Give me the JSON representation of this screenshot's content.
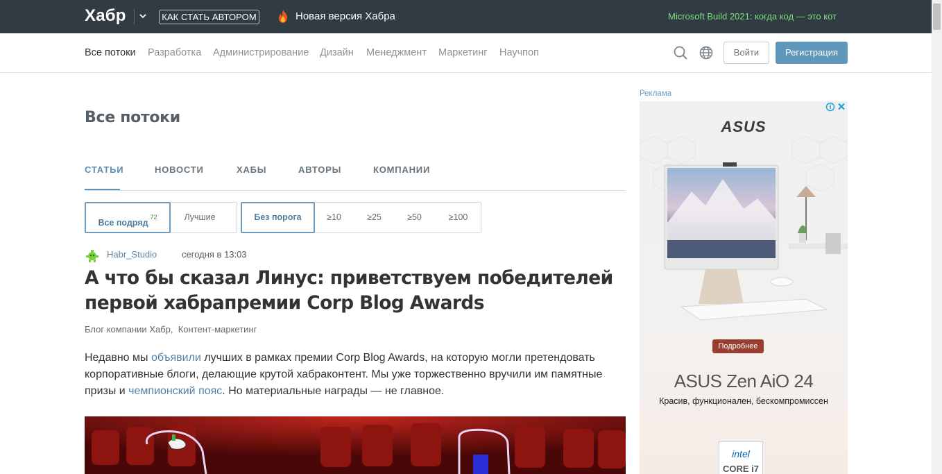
{
  "topbar": {
    "logo": "Хабр",
    "author_button": "КАК СТАТЬ АВТОРОМ",
    "new_version": "Новая версия Хабра",
    "promo_link": "Microsoft Build 2021: когда код — это кот",
    "colors": {
      "background": "#303b44",
      "promo": "#7ee07e"
    }
  },
  "nav": {
    "items": [
      {
        "label": "Все потоки",
        "active": true
      },
      {
        "label": "Разработка"
      },
      {
        "label": "Администрирование"
      },
      {
        "label": "Дизайн"
      },
      {
        "label": "Менеджмент"
      },
      {
        "label": "Маркетинг"
      },
      {
        "label": "Научпоп"
      }
    ],
    "search_icon": "search-icon",
    "language_icon": "globe-icon",
    "login": "Войти",
    "register": "Регистрация",
    "colors": {
      "register_button": "#5e96bc"
    }
  },
  "page": {
    "title": "Все потоки",
    "tabs": [
      {
        "label": "СТАТЬИ",
        "active": true
      },
      {
        "label": "НОВОСТИ"
      },
      {
        "label": "ХАБЫ"
      },
      {
        "label": "АВТОРЫ"
      },
      {
        "label": "КОМПАНИИ"
      }
    ],
    "sort_filters": {
      "all": "Все подряд",
      "all_count": "72",
      "best": "Лучшие"
    },
    "threshold_filters": [
      "Без порога",
      "≥10",
      "≥25",
      "≥50",
      "≥100"
    ]
  },
  "post": {
    "author": "Habr_Studio",
    "time": "сегодня в 13:03",
    "title": "А что бы сказал Линус: приветствуем победителей первой хабрапремии Corp Blog Awards",
    "hubs": [
      "Блог компании Хабр,",
      "Контент-маркетинг"
    ],
    "body": {
      "part1": "Недавно мы ",
      "link1": "объявили",
      "part2": " лучших в рамках премии Corp Blog Awards, на которую могли претендовать корпоративные блоги, делающие крутой хабраконтент. Мы уже торжественно вручили им памятные призы и ",
      "link2": "чемпионский пояс",
      "part3": ". Но материальные награды — не главное."
    }
  },
  "ad": {
    "label": "Реклама",
    "brand": "ASUS",
    "more": "Подробнее",
    "product": "ASUS Zen AiO 24",
    "tagline": "Красив, функционален, бескомпромиссен",
    "intel_logo": "intel",
    "intel_cpu": "CORE i7"
  }
}
